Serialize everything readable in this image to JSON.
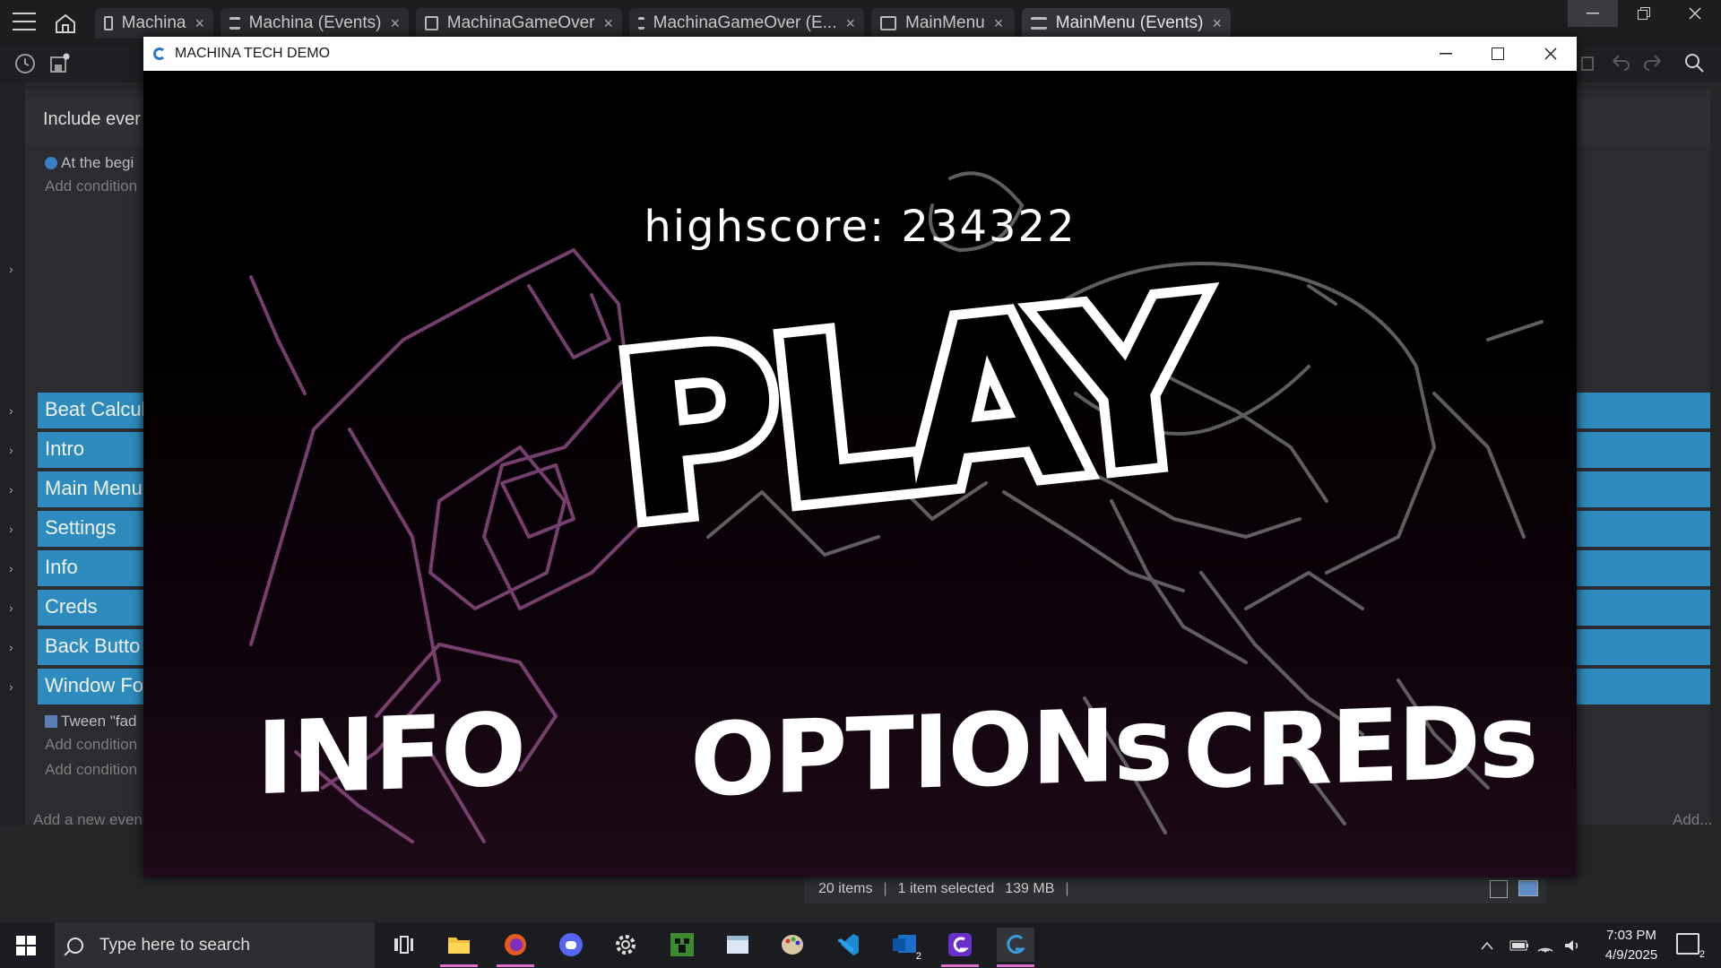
{
  "editor": {
    "tabs": [
      {
        "label": "Machina",
        "kind": "scene"
      },
      {
        "label": "Machina (Events)",
        "kind": "events"
      },
      {
        "label": "MachinaGameOver",
        "kind": "scene"
      },
      {
        "label": "MachinaGameOver (E...",
        "kind": "events"
      },
      {
        "label": "MainMenu",
        "kind": "scene"
      },
      {
        "label": "MainMenu (Events)",
        "kind": "events",
        "active": true
      }
    ],
    "tab_close_glyph": "×",
    "include_label": "Include ever",
    "at_beginning": "At the begi",
    "add_condition": "Add condition",
    "groups": [
      "Beat Calcul",
      "Intro",
      "Main Menu",
      "Settings",
      "Info",
      "Creds",
      "Back Butto",
      "Window Fo"
    ],
    "tween_text": "Tween \"fad",
    "add_new_event": "Add a new even",
    "add_right": "Add...",
    "group_color": "#2d8cbd"
  },
  "status_bar": {
    "items": "20 items",
    "selected": "1 item selected",
    "size": "139 MB"
  },
  "game_window": {
    "title": "MACHINA TECH DEMO",
    "highscore": "highscore: 234322",
    "play_label": "PLAY",
    "info_label": "INFO",
    "options_label": "OPTIONs",
    "creds_label": "CREDs"
  },
  "taskbar": {
    "search_placeholder": "Type here to search",
    "clock_time": "7:03 PM",
    "clock_date": "4/9/2025",
    "outlook_badge": "2",
    "notification_badge": "2",
    "apps": [
      "task-view-icon",
      "file-explorer-icon",
      "firefox-icon",
      "discord-icon",
      "settings-gear-icon",
      "minecraft-icon",
      "paint-icon",
      "palette-icon",
      "vscode-icon",
      "outlook-icon",
      "gdevelop-icon",
      "gdevelop-icon"
    ]
  }
}
